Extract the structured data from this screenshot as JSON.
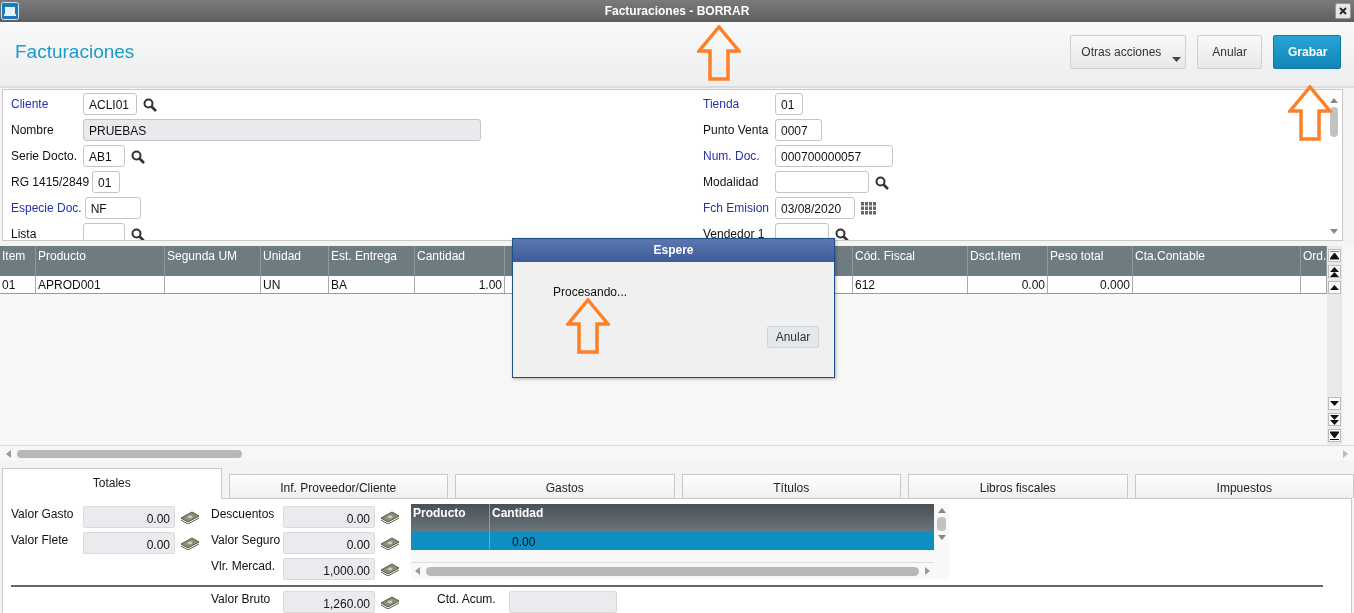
{
  "window": {
    "title": "Facturaciones - BORRAR"
  },
  "page_title": "Facturaciones",
  "actions": [
    {
      "label": "Otras acciones",
      "kind": "menu"
    },
    {
      "label": "Anular",
      "kind": "plain"
    },
    {
      "label": "Grabar",
      "kind": "primary"
    }
  ],
  "form_left": [
    {
      "label": "Cliente",
      "required": true,
      "disabled": false,
      "value": "ACLI01",
      "kind": "search"
    },
    {
      "label": "Nombre",
      "required": false,
      "disabled": true,
      "value": "PRUEBAS",
      "kind": "plain"
    },
    {
      "label": "Serie Docto.",
      "required": false,
      "disabled": false,
      "value": "AB1",
      "kind": "search"
    },
    {
      "label": "RG 1415/2849",
      "required": false,
      "disabled": false,
      "value": "01",
      "kind": "plain"
    },
    {
      "label": "Especie Doc.",
      "required": true,
      "disabled": false,
      "value": "NF",
      "kind": "plain"
    },
    {
      "label": "Lista",
      "required": false,
      "disabled": false,
      "kind": "search"
    }
  ],
  "form_right": [
    {
      "label": "Tienda",
      "required": true,
      "disabled": false,
      "value": "01",
      "kind": "plain"
    },
    {
      "label": "Punto Venta",
      "required": false,
      "disabled": false,
      "value": "0007",
      "kind": "plain"
    },
    {
      "label": "Num. Doc.",
      "required": true,
      "disabled": false,
      "value": "000700000057",
      "kind": "plain"
    },
    {
      "label": "Modalidad",
      "required": false,
      "disabled": false,
      "kind": "search"
    },
    {
      "label": "Fch Emision",
      "required": true,
      "disabled": false,
      "value": "03/08/2020",
      "kind": "calendar"
    },
    {
      "label": "Vendedor 1",
      "required": false,
      "disabled": false,
      "kind": "search"
    }
  ],
  "grid": {
    "columns": [
      "Item",
      "Producto",
      "Segunda UM",
      "Unidad",
      "Est. Entrega",
      "Cantidad",
      "Cód. Fiscal",
      "Dsct.Item",
      "Peso total",
      "Cta.Contable",
      "Ord."
    ],
    "rows": [
      {
        "cells": [
          "01",
          "APROD001",
          null,
          "UN",
          "BA",
          "1.00",
          "612",
          "0.00",
          "0.000",
          null,
          null
        ]
      }
    ]
  },
  "dialog": {
    "title": "Espere",
    "message": "Procesando...",
    "button": "Anular"
  },
  "tabs": [
    {
      "label": "Totales",
      "selected": true
    },
    {
      "label": "Inf. Proveedor/Cliente",
      "selected": false
    },
    {
      "label": "Gastos",
      "selected": false
    },
    {
      "label": "Títulos",
      "selected": false
    },
    {
      "label": "Libros fiscales",
      "selected": false
    },
    {
      "label": "Impuestos",
      "selected": false
    }
  ],
  "totals": {
    "left": [
      {
        "label": "Valor Gasto",
        "value": "0.00",
        "kind": "money"
      },
      {
        "label": "Valor Flete",
        "value": "0.00",
        "kind": "money"
      }
    ],
    "middle": [
      {
        "label": "Descuentos",
        "value": "0.00",
        "kind": "money"
      },
      {
        "label": "Valor Seguro",
        "value": "0.00",
        "kind": "money"
      },
      {
        "label": "Vlr. Mercad.",
        "value": "1,000.00",
        "kind": "money"
      }
    ],
    "summary": [
      {
        "label": "Valor Bruto",
        "value": "1,260.00",
        "kind": "money"
      },
      {
        "label": "Ctd. Acum.",
        "kind": "plain"
      }
    ],
    "mini_grid": {
      "columns": [
        "Producto",
        "Cantidad"
      ],
      "rows": [
        {
          "cells": [
            null,
            "0.00"
          ],
          "selected": true
        }
      ]
    }
  }
}
